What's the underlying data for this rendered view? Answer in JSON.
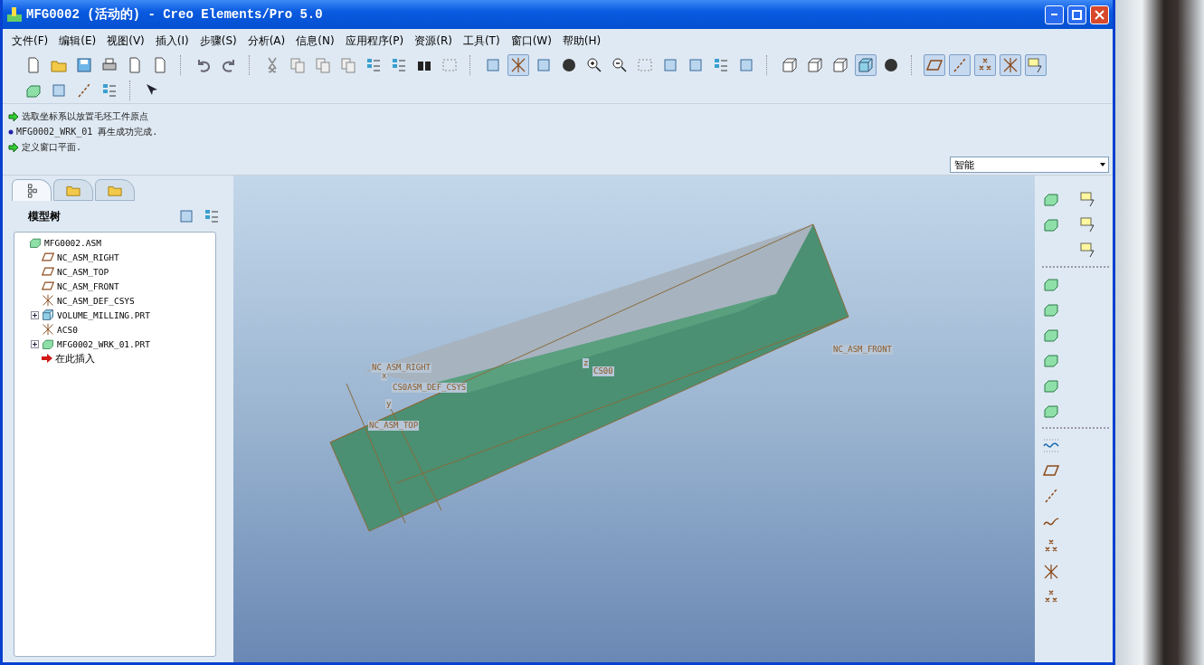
{
  "window": {
    "title": "MFG0002 (活动的) - Creo Elements/Pro 5.0"
  },
  "menu": [
    "文件(F)",
    "编辑(E)",
    "视图(V)",
    "插入(I)",
    "步骤(S)",
    "分析(A)",
    "信息(N)",
    "应用程序(P)",
    "资源(R)",
    "工具(T)",
    "窗口(W)",
    "帮助(H)"
  ],
  "toolbar": {
    "toggles": [
      {
        "on": true
      },
      {
        "on": true
      },
      {
        "on": true
      },
      {
        "on": true
      },
      {
        "on": true
      },
      {
        "on": true
      },
      {
        "on": true
      }
    ]
  },
  "messages": [
    {
      "kind": "prompt",
      "text": "选取坐标系以放置毛坯工件原点"
    },
    {
      "kind": "info",
      "text": "MFG0002_WRK_01 再生成功完成."
    },
    {
      "kind": "prompt",
      "text": "定义窗口平面."
    }
  ],
  "filter": {
    "value": "智能"
  },
  "navigator": {
    "tabs": [
      {
        "selected": true
      },
      {
        "selected": false
      },
      {
        "selected": false
      }
    ],
    "title": "模型树",
    "tree": [
      {
        "label": "MFG0002.ASM",
        "kind": "assembly",
        "children": [
          {
            "label": "NC_ASM_RIGHT",
            "kind": "plane"
          },
          {
            "label": "NC_ASM_TOP",
            "kind": "plane"
          },
          {
            "label": "NC_ASM_FRONT",
            "kind": "plane"
          },
          {
            "label": "NC_ASM_DEF_CSYS",
            "kind": "csys"
          },
          {
            "label": "VOLUME_MILLING.PRT",
            "kind": "part",
            "expanded": false
          },
          {
            "label": "ACS0",
            "kind": "csys"
          },
          {
            "label": "MFG0002_WRK_01.PRT",
            "kind": "workpiece",
            "expanded": false
          },
          {
            "label": "在此插入",
            "kind": "insert"
          }
        ]
      }
    ]
  },
  "viewport": {
    "labels": [
      "NC_ASM_RIGHT",
      "CS0ASM_DEF_CSYS",
      "NC_ASM_TOP",
      "CS00",
      "NC_ASM_FRONT",
      "x",
      "y",
      "z"
    ]
  }
}
